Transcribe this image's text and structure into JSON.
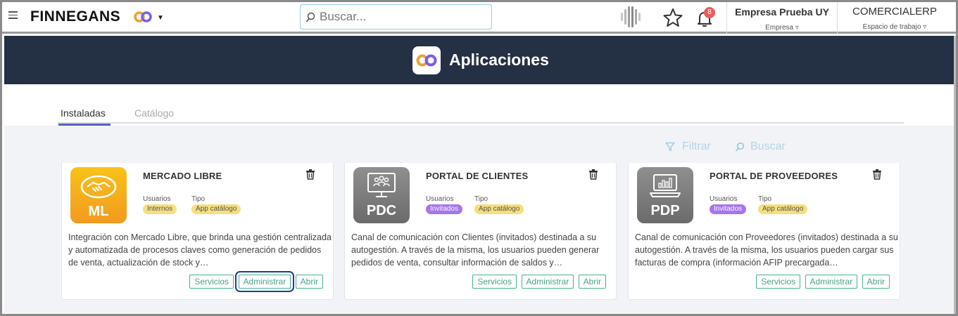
{
  "topbar": {
    "brand": "FINNEGANS",
    "search_placeholder": "Buscar...",
    "notifications_count": "8",
    "company_name": "Empresa Prueba UY",
    "company_label": "Empresa ▿",
    "workspace_name": "COMERCIALERP",
    "workspace_label": "Espacio de trabajo ▿"
  },
  "header": {
    "title": "Aplicaciones"
  },
  "tabs": [
    {
      "label": "Instaladas",
      "active": true
    },
    {
      "label": "Catálogo",
      "active": false
    }
  ],
  "toolbar": {
    "filter_label": "Filtrar",
    "search_label": "Buscar"
  },
  "labels": {
    "users": "Usuarios",
    "type": "Tipo"
  },
  "apps": [
    {
      "abbr": "ML",
      "title": "MERCADO LIBRE",
      "users": "Internos",
      "type": "App catálogo",
      "description": "Integración con Mercado Libre, que brinda una gestión centralizada y automatizada de procesos claves como generación de pedidos de venta, actualización de stock y…",
      "buttons": [
        "Servicios",
        "Administrar",
        "Abrir"
      ]
    },
    {
      "abbr": "PDC",
      "title": "PORTAL DE CLIENTES",
      "users": "Invitados",
      "type": "App catálogo",
      "description": "Canal de comunicación con Clientes (invitados) destinada a su autogestión. A través de la misma, los usuarios pueden generar pedidos de venta, consultar información de saldos y…",
      "buttons": [
        "Servicios",
        "Administrar",
        "Abrir"
      ]
    },
    {
      "abbr": "PDP",
      "title": "PORTAL DE PROVEEDORES",
      "users": "Invitados",
      "type": "App catálogo",
      "description": "Canal de comunicación con Proveedores (invitados) destinada a su autogestión. A través de la misma, los usuarios pueden cargar sus facturas de compra (información AFIP precargada…",
      "buttons": [
        "Servicios",
        "Administrar",
        "Abrir"
      ]
    }
  ],
  "colors": {
    "header_band": "#243044",
    "tab_accent": "#5b5fc7",
    "button_accent": "#46b28c",
    "pill_internal": "#f6df7d",
    "pill_invited": "#a574f0"
  }
}
